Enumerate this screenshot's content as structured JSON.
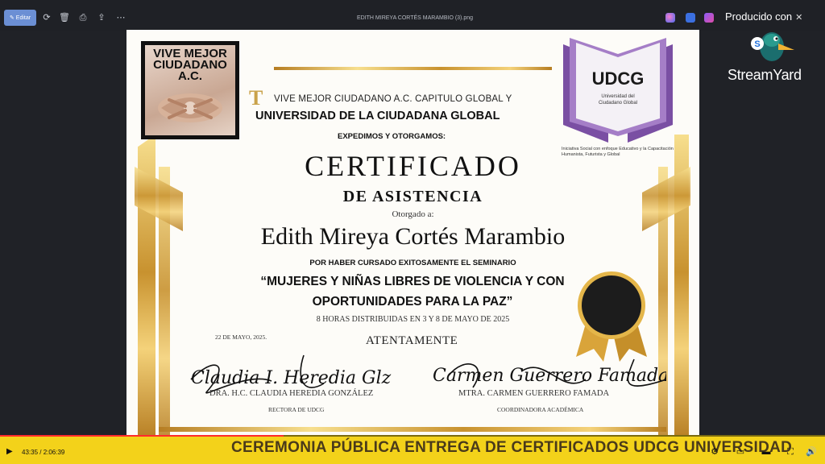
{
  "toolbar": {
    "edit_label": "Editar",
    "file_name": "EDITH MIREYA CORTÉS MARAMBIO (3).png",
    "icons": [
      "rotate-icon",
      "delete-icon",
      "print-icon",
      "share-icon",
      "more-icon"
    ]
  },
  "overlay": {
    "produced_label": "Producido con",
    "close_symbol": "✕",
    "brand": "StreamYard"
  },
  "certificate": {
    "left_logo_text": "VIVE MEJOR CIUDADANO A.C.",
    "udcg": {
      "acronym": "UDCG",
      "caption": "Universidad del Ciudadano Global",
      "tagline": "Iniciativa Social con enfoque Educativo y la Capacitación Humanista, Futurista y Global"
    },
    "issuer_line_1": "VIVE MEJOR CIUDADANO A.C. CAPITULO GLOBAL Y",
    "issuer_line_2": "UNIVERSIDAD DE LA CIUDADANA GLOBAL",
    "issuer_line_3": "EXPEDIMOS Y OTORGAMOS:",
    "title": "CERTIFICADO",
    "subtitle": "DE ASISTENCIA",
    "awarded_to": "Otorgado a:",
    "recipient": "Edith Mireya Cortés Marambio",
    "reason": "POR HABER CURSADO EXITOSAMENTE EL SEMINARIO",
    "seminar": "“MUJERES Y NIÑAS LIBRES DE VIOLENCIA Y CON OPORTUNIDADES PARA LA PAZ”",
    "hours": "8 HORAS DISTRIBUIDAS EN 3 Y 8 DE MAYO DE 2025",
    "date": "22 DE MAYO, 2025.",
    "closing": "ATENTAMENTE",
    "signatures": [
      {
        "script": "Claudia I. Heredia Glz",
        "name": "DRA. H.C. CLAUDIA HEREDIA GONZÁLEZ",
        "role": "RECTORA DE UDCG"
      },
      {
        "script": "Carmen Guerrero Famada",
        "name": "MTRA. CARMEN GUERRERO FAMADA",
        "role": "COORDINADORA ACADÉMICA"
      }
    ]
  },
  "player": {
    "time": "43:35 / 2:06:39",
    "progress": 0.344,
    "ticker": "CEREMONIA PÚBLICA ENTREGA DE CERTIFICADOS UDCG UNIVERSIDAD",
    "icons": [
      "play-icon",
      "settings-icon",
      "miniplayer-icon",
      "theater-icon",
      "fullscreen-icon",
      "volume-icon"
    ]
  },
  "colors": {
    "gold": "#c8922f",
    "udcg_purple": "#7a4fa3",
    "ticker_yellow": "#f3d21a",
    "toolbar_blue": "#6b8fd4"
  }
}
